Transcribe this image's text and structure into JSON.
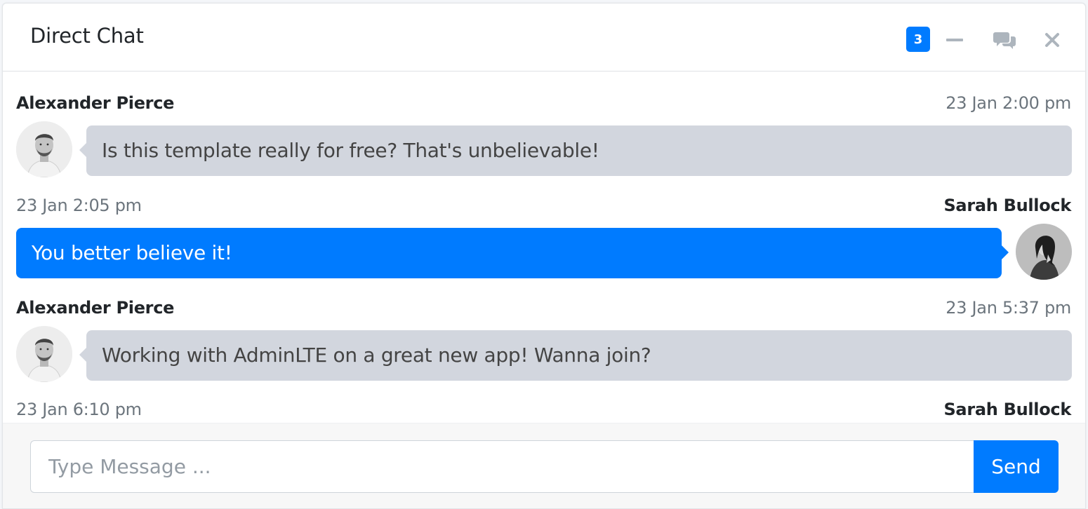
{
  "header": {
    "title": "Direct Chat",
    "badge_count": "3",
    "badge_color": "#007bff",
    "tools": [
      "minus-icon",
      "comments-icon",
      "close-icon"
    ]
  },
  "messages": [
    {
      "name": "Alexander Pierce",
      "time": "23 Jan 2:00 pm",
      "text": "Is this template really for free? That's unbelievable!",
      "side": "left"
    },
    {
      "name": "Sarah Bullock",
      "time": "23 Jan 2:05 pm",
      "text": "You better believe it!",
      "side": "right"
    },
    {
      "name": "Alexander Pierce",
      "time": "23 Jan 5:37 pm",
      "text": "Working with AdminLTE on a great new app! Wanna join?",
      "side": "left"
    },
    {
      "name": "Sarah Bullock",
      "time": "23 Jan 6:10 pm",
      "text": "",
      "side": "right"
    }
  ],
  "footer": {
    "placeholder": "Type Message ...",
    "send_label": "Send"
  },
  "colors": {
    "accent": "#007bff",
    "bubble_left": "#d2d6de"
  }
}
